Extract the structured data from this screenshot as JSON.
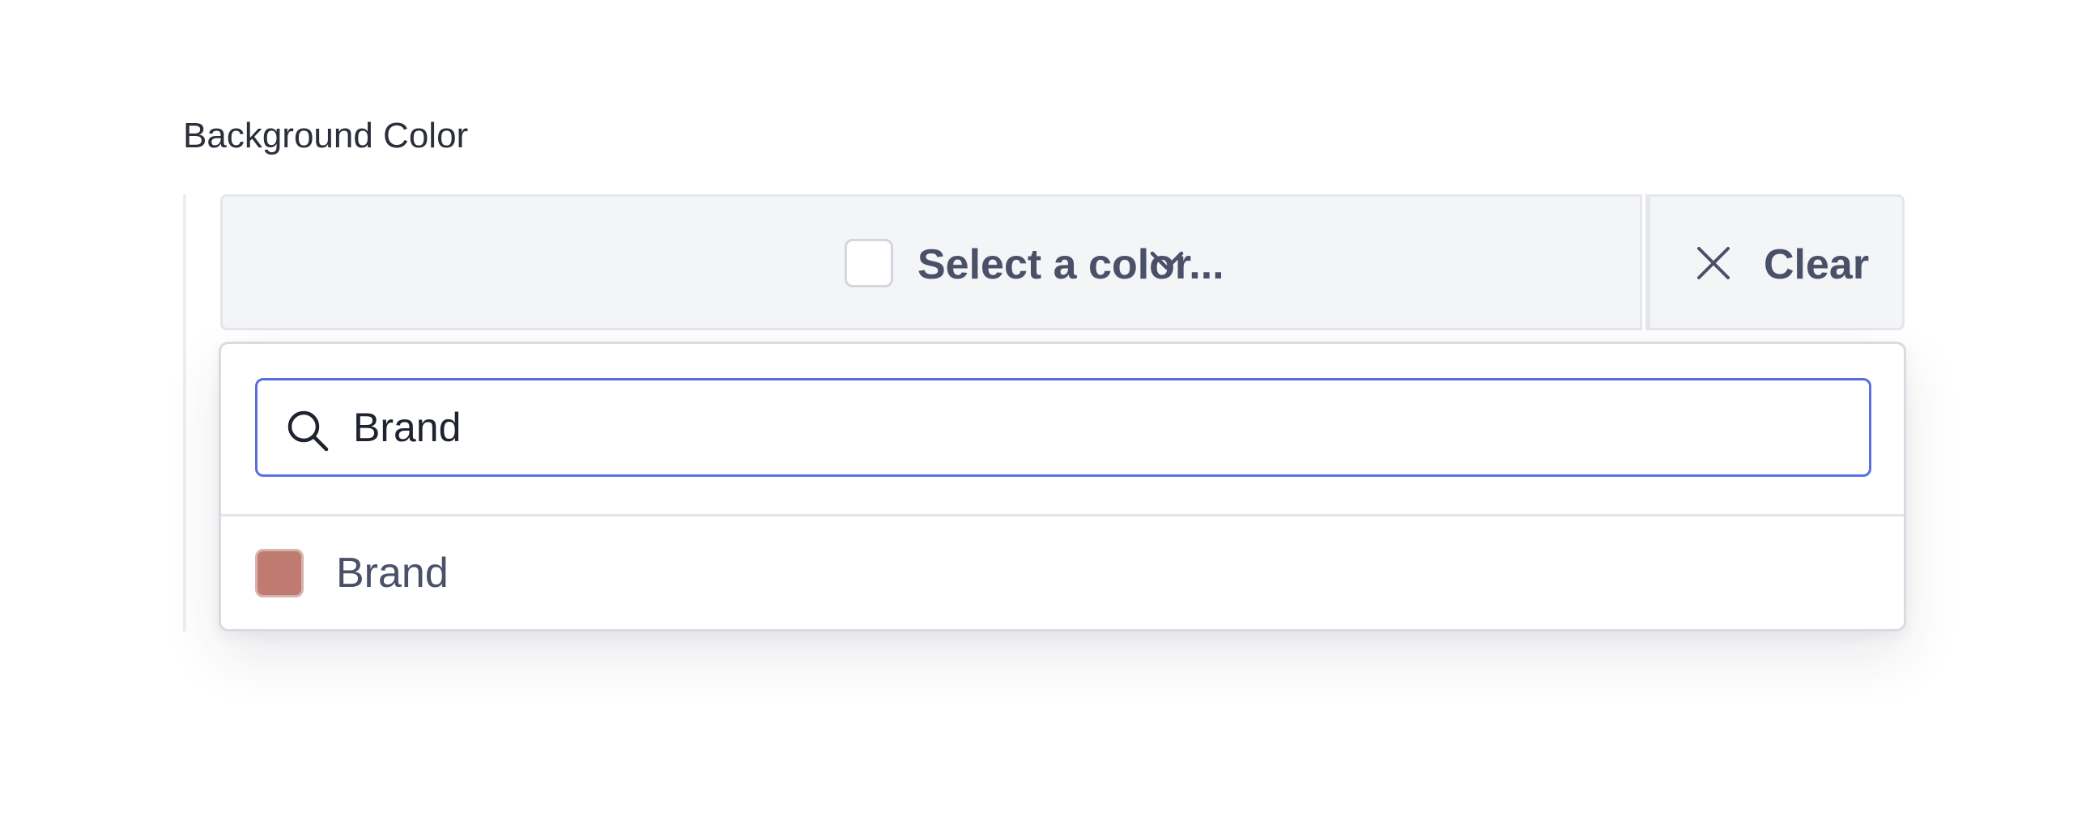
{
  "field": {
    "label": "Background Color"
  },
  "trigger": {
    "placeholder": "Select a color...",
    "chevron_icon": "chevron-down-icon"
  },
  "clear": {
    "label": "Clear",
    "icon": "close-icon"
  },
  "search": {
    "icon": "search-icon",
    "value": "Brand"
  },
  "options": [
    {
      "label": "Brand",
      "color": "#c07b70"
    }
  ],
  "colors": {
    "focus_border": "#5b6ee0",
    "text": "#4a5068",
    "trigger_bg": "#f4f5f7"
  }
}
